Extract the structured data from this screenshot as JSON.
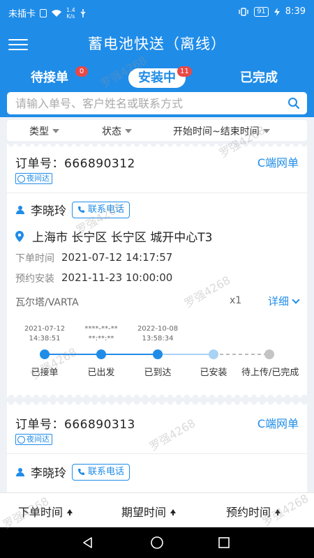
{
  "status_bar": {
    "carrier": "未插卡",
    "speed_value": "1.4",
    "speed_unit": "K/s",
    "battery": "91",
    "time": "8:39"
  },
  "header": {
    "title": "蓄电池快送（离线）"
  },
  "tabs": [
    {
      "label": "待接单",
      "badge": "0"
    },
    {
      "label": "安装中",
      "badge": "11"
    },
    {
      "label": "已完成"
    }
  ],
  "search": {
    "placeholder": "请输入单号、客户姓名或联系方式"
  },
  "filters": {
    "type": "类型",
    "status": "状态",
    "time_range": "开始时间~结束时间"
  },
  "orders": [
    {
      "order_label": "订单号：",
      "order_no": "666890312",
      "order_type": "C端网单",
      "tag": "夜间达",
      "customer_name": "李晓玲",
      "phone_label": "联系电话",
      "address": "上海市 长宁区 长宁区 城开中心T3",
      "order_time_label": "下单时间",
      "order_time": "2021-07-12 14:17:57",
      "install_time_label": "预约安装",
      "install_time": "2021-11-23 10:00:00",
      "product": "瓦尔塔/VARTA",
      "quantity": "x1",
      "detail_label": "详细",
      "timeline": [
        {
          "date": "2021-07-12",
          "time": "14:38:51",
          "label": "已接单"
        },
        {
          "date": "****-**-**",
          "time": "**:**:**",
          "label": "已出发"
        },
        {
          "date": "2022-10-08",
          "time": "13:58:34",
          "label": "已到达"
        },
        {
          "label": "已安装"
        },
        {
          "label": "待上传/已完成"
        }
      ]
    },
    {
      "order_label": "订单号：",
      "order_no": "666890313",
      "order_type": "C端网单",
      "tag": "夜间达",
      "customer_name": "李晓玲",
      "phone_label": "联系电话"
    }
  ],
  "sort_bar": {
    "order_time": "下单时间",
    "expected_time": "期望时间",
    "appointment_time": "预约时间"
  },
  "watermark": "罗强4268",
  "colors": {
    "primary": "#1f8ce8",
    "badge": "#e84848",
    "step_done": "#1f8ce8",
    "step_current": "#a9d2f5",
    "step_pending": "#c4c4c4"
  }
}
